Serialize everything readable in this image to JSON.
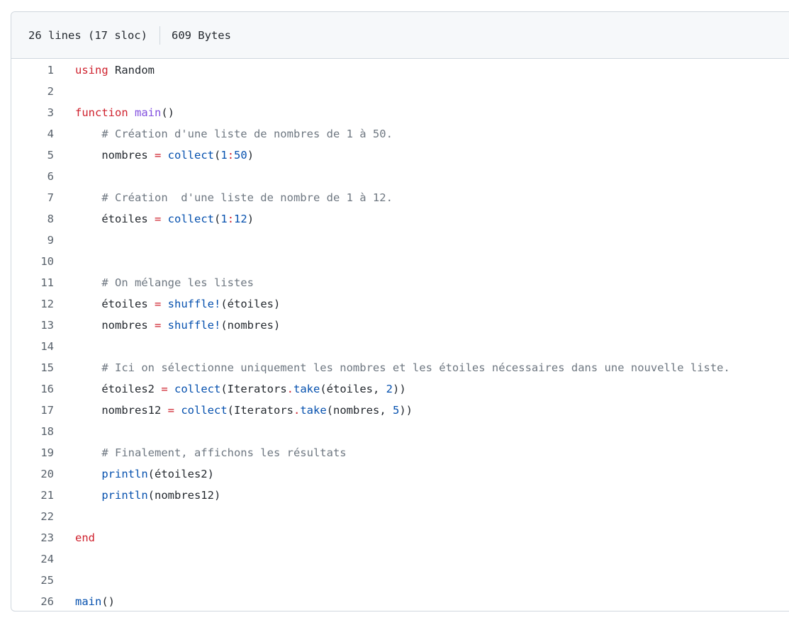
{
  "header": {
    "lines_info": "26 lines (17 sloc)",
    "size_info": "609 Bytes"
  },
  "colors": {
    "keyword": "#cf222e",
    "function_name": "#8250df",
    "builtin_call": "#0550ae",
    "comment": "#6e7781",
    "number": "#0550ae",
    "line_number": "#57606a",
    "border": "#d0d7de",
    "header_bg": "#f6f8fa"
  },
  "code_lines": [
    {
      "n": "1",
      "tokens": [
        [
          "kw",
          "using"
        ],
        [
          "id",
          " Random"
        ]
      ]
    },
    {
      "n": "2",
      "tokens": []
    },
    {
      "n": "3",
      "tokens": [
        [
          "kw",
          "function"
        ],
        [
          "id",
          " "
        ],
        [
          "fn",
          "main"
        ],
        [
          "id",
          "()"
        ]
      ]
    },
    {
      "n": "4",
      "tokens": [
        [
          "id",
          "    "
        ],
        [
          "cm",
          "# Création d'une liste de nombres de 1 à 50."
        ]
      ]
    },
    {
      "n": "5",
      "tokens": [
        [
          "id",
          "    nombres "
        ],
        [
          "op",
          "="
        ],
        [
          "id",
          " "
        ],
        [
          "call",
          "collect"
        ],
        [
          "id",
          "("
        ],
        [
          "nm",
          "1"
        ],
        [
          "op",
          ":"
        ],
        [
          "nm",
          "50"
        ],
        [
          "id",
          ")"
        ]
      ]
    },
    {
      "n": "6",
      "tokens": []
    },
    {
      "n": "7",
      "tokens": [
        [
          "id",
          "    "
        ],
        [
          "cm",
          "# Création  d'une liste de nombre de 1 à 12."
        ]
      ]
    },
    {
      "n": "8",
      "tokens": [
        [
          "id",
          "    étoiles "
        ],
        [
          "op",
          "="
        ],
        [
          "id",
          " "
        ],
        [
          "call",
          "collect"
        ],
        [
          "id",
          "("
        ],
        [
          "nm",
          "1"
        ],
        [
          "op",
          ":"
        ],
        [
          "nm",
          "12"
        ],
        [
          "id",
          ")"
        ]
      ]
    },
    {
      "n": "9",
      "tokens": []
    },
    {
      "n": "10",
      "tokens": []
    },
    {
      "n": "11",
      "tokens": [
        [
          "id",
          "    "
        ],
        [
          "cm",
          "# On mélange les listes"
        ]
      ]
    },
    {
      "n": "12",
      "tokens": [
        [
          "id",
          "    étoiles "
        ],
        [
          "op",
          "="
        ],
        [
          "id",
          " "
        ],
        [
          "call",
          "shuffle!"
        ],
        [
          "id",
          "(étoiles)"
        ]
      ]
    },
    {
      "n": "13",
      "tokens": [
        [
          "id",
          "    nombres "
        ],
        [
          "op",
          "="
        ],
        [
          "id",
          " "
        ],
        [
          "call",
          "shuffle!"
        ],
        [
          "id",
          "(nombres)"
        ]
      ]
    },
    {
      "n": "14",
      "tokens": []
    },
    {
      "n": "15",
      "tokens": [
        [
          "id",
          "    "
        ],
        [
          "cm",
          "# Ici on sélectionne uniquement les nombres et les étoiles nécessaires dans une nouvelle liste."
        ]
      ]
    },
    {
      "n": "16",
      "tokens": [
        [
          "id",
          "    étoiles2 "
        ],
        [
          "op",
          "="
        ],
        [
          "id",
          " "
        ],
        [
          "call",
          "collect"
        ],
        [
          "id",
          "(Iterators"
        ],
        [
          "op",
          "."
        ],
        [
          "call",
          "take"
        ],
        [
          "id",
          "(étoiles, "
        ],
        [
          "nm",
          "2"
        ],
        [
          "id",
          "))"
        ]
      ]
    },
    {
      "n": "17",
      "tokens": [
        [
          "id",
          "    nombres12 "
        ],
        [
          "op",
          "="
        ],
        [
          "id",
          " "
        ],
        [
          "call",
          "collect"
        ],
        [
          "id",
          "(Iterators"
        ],
        [
          "op",
          "."
        ],
        [
          "call",
          "take"
        ],
        [
          "id",
          "(nombres, "
        ],
        [
          "nm",
          "5"
        ],
        [
          "id",
          "))"
        ]
      ]
    },
    {
      "n": "18",
      "tokens": []
    },
    {
      "n": "19",
      "tokens": [
        [
          "id",
          "    "
        ],
        [
          "cm",
          "# Finalement, affichons les résultats"
        ]
      ]
    },
    {
      "n": "20",
      "tokens": [
        [
          "id",
          "    "
        ],
        [
          "call",
          "println"
        ],
        [
          "id",
          "(étoiles2)"
        ]
      ]
    },
    {
      "n": "21",
      "tokens": [
        [
          "id",
          "    "
        ],
        [
          "call",
          "println"
        ],
        [
          "id",
          "(nombres12)"
        ]
      ]
    },
    {
      "n": "22",
      "tokens": []
    },
    {
      "n": "23",
      "tokens": [
        [
          "kw",
          "end"
        ]
      ]
    },
    {
      "n": "24",
      "tokens": []
    },
    {
      "n": "25",
      "tokens": []
    },
    {
      "n": "26",
      "tokens": [
        [
          "call",
          "main"
        ],
        [
          "id",
          "()"
        ]
      ]
    }
  ]
}
